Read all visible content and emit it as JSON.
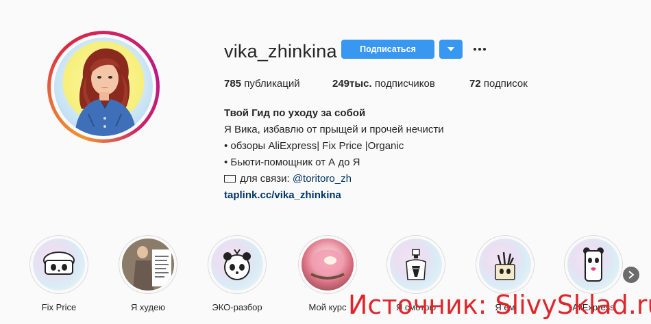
{
  "profile": {
    "username": "vika_zhinkina",
    "follow_label": "Подписаться"
  },
  "stats": {
    "posts_count": "785",
    "posts_label": "публикаций",
    "followers_count": "249тыс.",
    "followers_label": "подписчиков",
    "following_count": "72",
    "following_label": "подписок"
  },
  "bio": {
    "name": "Твой Гид по уходу за собой",
    "line1": "Я Вика, избавлю от прыщей и прочей нечисти",
    "line2": "• обзоры AliExpress| Fix Price |Organic",
    "line3": "• Бьюти-помощник от А до Я",
    "contact_prefix": "для связи:",
    "contact_handle": "@toritoro_zh",
    "website": "taplink.cc/vika_zhinkina"
  },
  "highlights": [
    {
      "label": "Fix Price",
      "icon": "panda-box-icon"
    },
    {
      "label": "Я худею",
      "icon": "photo-icon"
    },
    {
      "label": "ЭКО-разбор",
      "icon": "panda-face-icon"
    },
    {
      "label": "Мой курс",
      "icon": "cream-jar-icon"
    },
    {
      "label": "Я смотрю",
      "icon": "perfume-icon"
    },
    {
      "label": "Я ем",
      "icon": "brush-cup-icon"
    },
    {
      "label": "AliExpress",
      "icon": "panda-phone-icon"
    }
  ],
  "watermark": "Источник: SlivySklad.ru",
  "colors": {
    "accent": "#3897f0",
    "link": "#003569",
    "watermark": "#e0262b"
  }
}
